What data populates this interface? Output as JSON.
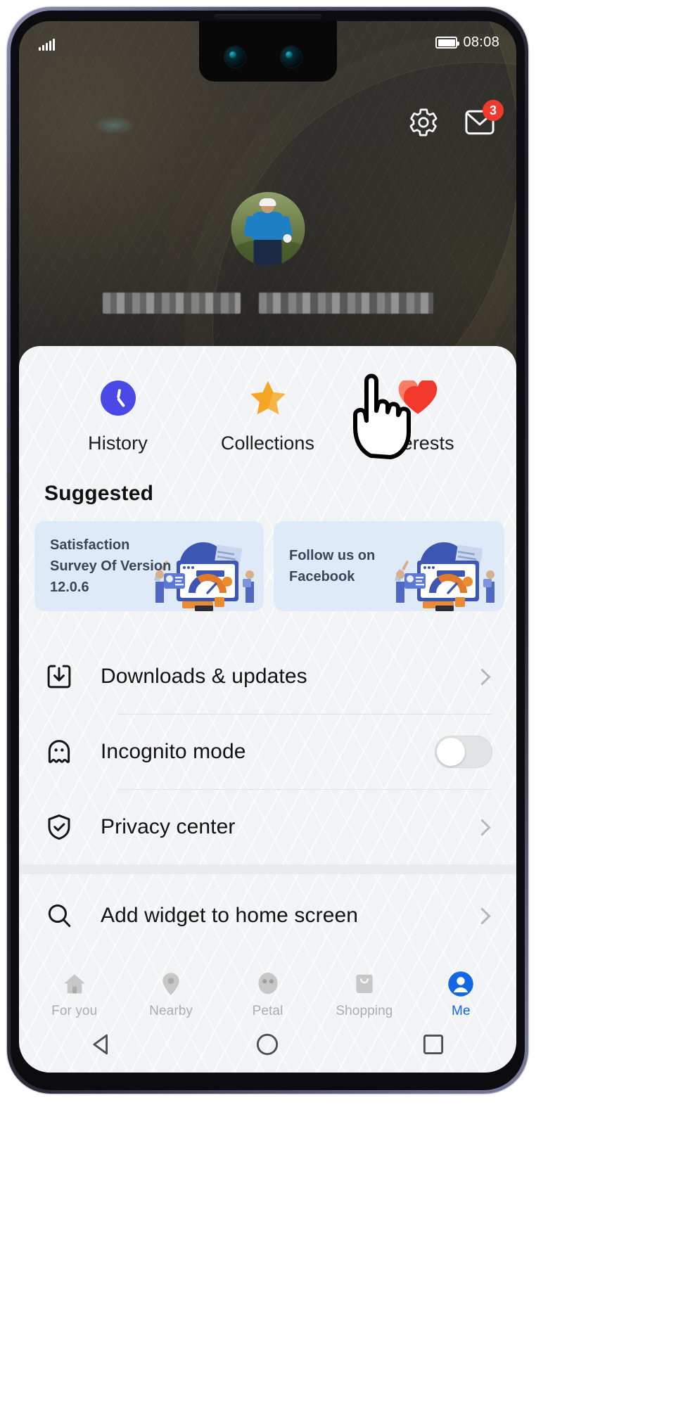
{
  "status_bar": {
    "signal_icon": "signal-bars-icon",
    "battery_icon": "battery-full-icon",
    "time": "08:08"
  },
  "header": {
    "settings_icon": "gear-icon",
    "messages_icon": "envelope-icon",
    "messages_badge": "3",
    "avatar_alt": "profile-avatar",
    "username_masked": "",
    "background_alt": "abstract-golden-arc-wallpaper"
  },
  "shortcuts": [
    {
      "label": "History",
      "icon": "clock-icon",
      "color": "#4a49e8"
    },
    {
      "label": "Collections",
      "icon": "star-icon",
      "color": "#f6a623"
    },
    {
      "label": "Interests",
      "icon": "heart-icon",
      "color": "#f0392b"
    }
  ],
  "suggested": {
    "title": "Suggested",
    "cards": [
      {
        "text": "Satisfaction Survey Of Version 12.0.6",
        "art": "survey-dashboard-illustration",
        "bg": "#dfeaf9"
      },
      {
        "text": "Follow us on Facebook",
        "art": "survey-dashboard-illustration",
        "bg": "#dfeaf9"
      }
    ]
  },
  "menu": [
    {
      "label": "Downloads & updates",
      "icon": "download-box-icon",
      "control": "chevron",
      "chevron_icon": "chevron-right-icon"
    },
    {
      "label": "Incognito mode",
      "icon": "ghost-icon",
      "control": "toggle",
      "toggle_on": false
    },
    {
      "label": "Privacy center",
      "icon": "shield-check-icon",
      "control": "chevron",
      "chevron_icon": "chevron-right-icon"
    },
    {
      "label": "Add widget to home screen",
      "icon": "search-icon",
      "control": "chevron",
      "chevron_icon": "chevron-right-icon"
    }
  ],
  "tabbar": {
    "active_color": "#1268e3",
    "inactive_color": "#adadad",
    "tabs": [
      {
        "label": "For you",
        "icon": "home-icon",
        "active": false
      },
      {
        "label": "Nearby",
        "icon": "location-pin-icon",
        "active": false
      },
      {
        "label": "Petal",
        "icon": "petal-face-icon",
        "active": false
      },
      {
        "label": "Shopping",
        "icon": "shopping-bag-icon",
        "active": false
      },
      {
        "label": "Me",
        "icon": "person-icon",
        "active": true
      }
    ]
  },
  "navbar": {
    "back_icon": "triangle-back-icon",
    "home_icon": "circle-home-icon",
    "recents_icon": "square-recents-icon"
  },
  "cursor": {
    "icon": "pointing-hand-cursor"
  }
}
